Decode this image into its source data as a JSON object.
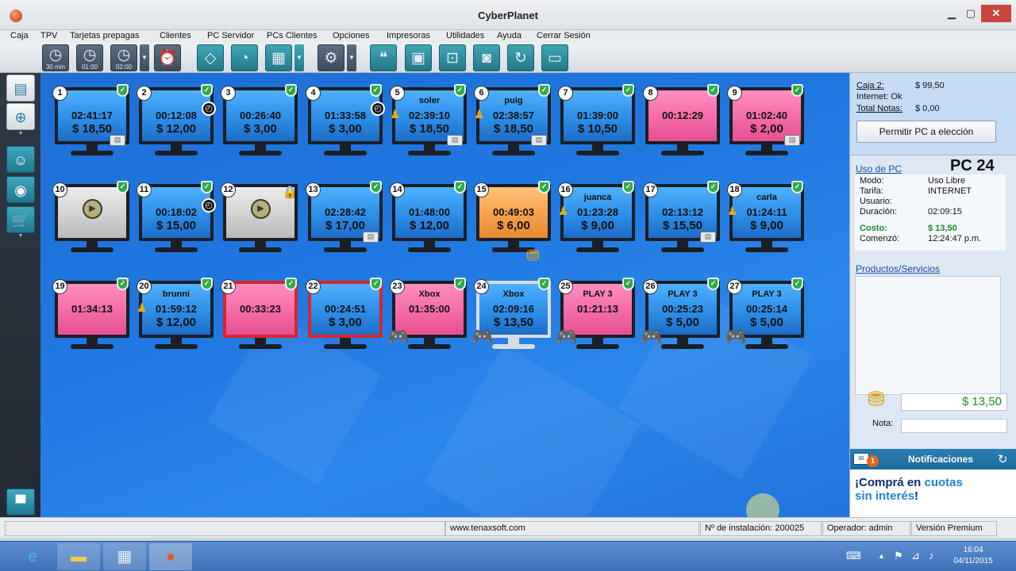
{
  "window": {
    "title": "CyberPlanet"
  },
  "menu": [
    "Caja",
    "TPV",
    "Tarjetas prepagas",
    "Clientes",
    "PC Servidor",
    "PCs Clientes",
    "Opciones",
    "Impresoras",
    "Utilidades",
    "Ayuda",
    "Cerrar Sesión"
  ],
  "toolbar": {
    "clock1_label": "30 min",
    "clock2_label": "01:00",
    "clock3_label": "02:00"
  },
  "pcs": [
    {
      "num": "1",
      "user": "",
      "time": "02:41:17",
      "cost": "$ 18,50",
      "state": "blue",
      "icons": [
        "printer"
      ]
    },
    {
      "num": "2",
      "user": "",
      "time": "00:12:08",
      "cost": "$ 12,00",
      "state": "blue",
      "icons": [
        "clock"
      ]
    },
    {
      "num": "3",
      "user": "",
      "time": "00:26:40",
      "cost": "$ 3,00",
      "state": "blue",
      "icons": []
    },
    {
      "num": "4",
      "user": "",
      "time": "01:33:58",
      "cost": "$ 3,00",
      "state": "blue",
      "icons": [
        "clock"
      ]
    },
    {
      "num": "5",
      "user": "soler",
      "time": "02:39:10",
      "cost": "$ 18,50",
      "state": "blue",
      "icons": [
        "users",
        "printer"
      ]
    },
    {
      "num": "6",
      "user": "puig",
      "time": "02:38:57",
      "cost": "$ 18,50",
      "state": "blue",
      "icons": [
        "users",
        "printer"
      ]
    },
    {
      "num": "7",
      "user": "",
      "time": "01:39:00",
      "cost": "$ 10,50",
      "state": "blue",
      "icons": []
    },
    {
      "num": "8",
      "user": "",
      "time": "00:12:29",
      "cost": "",
      "state": "pink",
      "icons": []
    },
    {
      "num": "9",
      "user": "",
      "time": "01:02:40",
      "cost": "$ 2,00",
      "state": "pink",
      "icons": [
        "printer"
      ]
    },
    {
      "num": "10",
      "user": "",
      "time": "",
      "cost": "",
      "state": "gray",
      "icons": [
        "play"
      ]
    },
    {
      "num": "11",
      "user": "",
      "time": "00:18:02",
      "cost": "$ 15,00",
      "state": "blue",
      "icons": [
        "clock"
      ]
    },
    {
      "num": "12",
      "user": "",
      "time": "",
      "cost": "",
      "state": "gray",
      "icons": [
        "play",
        "lock"
      ]
    },
    {
      "num": "13",
      "user": "",
      "time": "02:28:42",
      "cost": "$ 17,00",
      "state": "blue",
      "icons": [
        "printer"
      ]
    },
    {
      "num": "14",
      "user": "",
      "time": "01:48:00",
      "cost": "$ 12,00",
      "state": "blue",
      "icons": []
    },
    {
      "num": "15",
      "user": "",
      "time": "00:49:03",
      "cost": "$ 6,00",
      "state": "orange",
      "icons": [
        "coins"
      ]
    },
    {
      "num": "16",
      "user": "juanca",
      "time": "01:23:28",
      "cost": "$ 9,00",
      "state": "blue",
      "icons": [
        "users"
      ]
    },
    {
      "num": "17",
      "user": "",
      "time": "02:13:12",
      "cost": "$ 15,50",
      "state": "blue",
      "icons": [
        "printer"
      ]
    },
    {
      "num": "18",
      "user": "carla",
      "time": "01:24:11",
      "cost": "$ 9,00",
      "state": "blue",
      "icons": [
        "users"
      ]
    },
    {
      "num": "19",
      "user": "",
      "time": "01:34:13",
      "cost": "",
      "state": "pink",
      "icons": []
    },
    {
      "num": "20",
      "user": "brunni",
      "time": "01:59:12",
      "cost": "$ 12,00",
      "state": "blue",
      "icons": [
        "users"
      ]
    },
    {
      "num": "21",
      "user": "",
      "time": "00:33:23",
      "cost": "",
      "state": "pink-red",
      "icons": []
    },
    {
      "num": "22",
      "user": "",
      "time": "00:24:51",
      "cost": "$ 3,00",
      "state": "blue-red",
      "icons": []
    },
    {
      "num": "23",
      "user": "Xbox",
      "time": "01:35:00",
      "cost": "",
      "state": "pink",
      "icons": [
        "gamepad"
      ]
    },
    {
      "num": "24",
      "user": "Xbox",
      "time": "02:09:16",
      "cost": "$ 13,50",
      "state": "blue-silver",
      "icons": [
        "gamepad"
      ]
    },
    {
      "num": "25",
      "user": "PLAY 3",
      "time": "01:21:13",
      "cost": "",
      "state": "pink",
      "icons": [
        "gamepad"
      ]
    },
    {
      "num": "26",
      "user": "PLAY 3",
      "time": "00:25:23",
      "cost": "$ 5,00",
      "state": "blue",
      "icons": [
        "gamepad"
      ]
    },
    {
      "num": "27",
      "user": "PLAY 3",
      "time": "00:25:14",
      "cost": "$ 5,00",
      "state": "blue",
      "icons": [
        "gamepad"
      ]
    }
  ],
  "right": {
    "caja_label": "Caja 2:",
    "caja_value": "$ 99,50",
    "internet_label": "Internet: Ok",
    "total_label": "Total Notas:",
    "total_value": "$ 0,00",
    "permit_button": "Permitir PC a elección",
    "uso_link": "Uso de PC",
    "pc_title": "PC 24",
    "fields": [
      {
        "label": "Modo:",
        "value": "Uso Libre"
      },
      {
        "label": "Tarifa:",
        "value": "INTERNET"
      },
      {
        "label": "Usuario:",
        "value": ""
      },
      {
        "label": "Duración:",
        "value": "02:09:15"
      },
      {
        "label": "Costo:",
        "value": "$ 13,50"
      },
      {
        "label": "Comenzó:",
        "value": "12:24:47 p.m."
      }
    ],
    "productos_link": "Productos/Servicios",
    "total_amount": "$ 13,50",
    "nota_label": "Nota:",
    "notif_title": "Notificaciones",
    "notif_count": "1",
    "promo_l1a": "¡Comprá en ",
    "promo_l1b": "cuotas",
    "promo_l2a": "sin interés",
    "promo_l2b": "!"
  },
  "status": {
    "web": "www.tenaxsoft.com",
    "install": "Nº de instalación: 200025",
    "operator": "Operador: admin",
    "version": "Versión Premium"
  },
  "taskbar": {
    "time": "16:04",
    "date": "04/11/2015"
  },
  "colors": {
    "desk_blue": "#1f77e0",
    "pc_blue": "#2d8ee8",
    "pc_pink": "#f56aa8",
    "pc_orange": "#f6a04a",
    "accent_green": "#1d8a2a"
  }
}
